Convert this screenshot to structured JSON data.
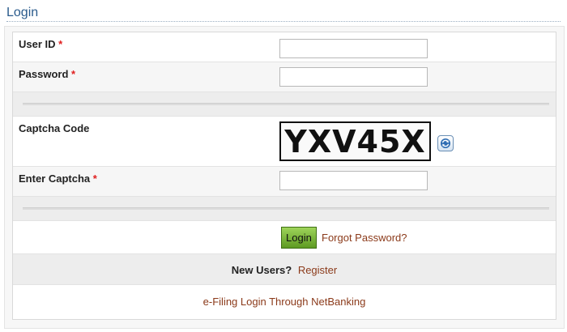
{
  "page": {
    "title": "Login"
  },
  "form": {
    "user_id": {
      "label": "User ID",
      "required_mark": "*",
      "value": "",
      "placeholder": ""
    },
    "password": {
      "label": "Password",
      "required_mark": "*",
      "value": "",
      "placeholder": ""
    },
    "captcha": {
      "label": "Captcha Code",
      "image_text": "YXV45X",
      "refresh_icon": "refresh-icon"
    },
    "enter_captcha": {
      "label": "Enter Captcha",
      "required_mark": "*",
      "value": "",
      "placeholder": ""
    },
    "login_button": "Login",
    "forgot_password": "Forgot Password?",
    "new_users": "New Users?",
    "register": "Register",
    "netbanking": "e-Filing Login Through NetBanking"
  },
  "colors": {
    "title": "#2a5b8c",
    "required": "#e02020",
    "link": "#8b3a1a",
    "login_button": "#7bb83e"
  }
}
